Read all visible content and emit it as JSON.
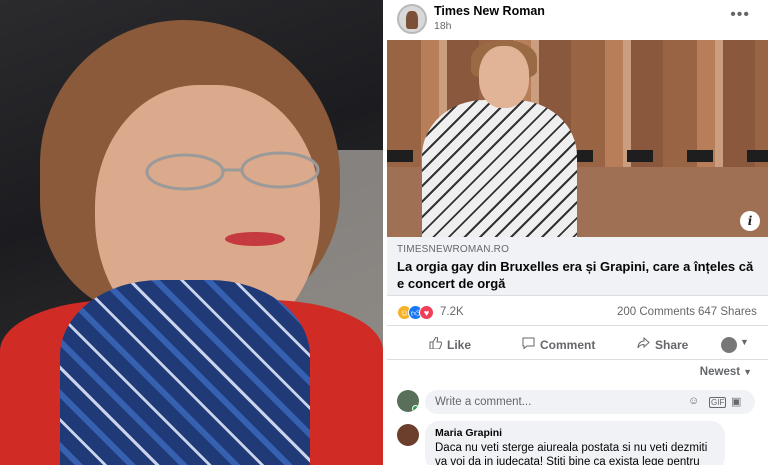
{
  "post": {
    "page_name": "Times New Roman",
    "time": "18h",
    "more_label": "•••",
    "info_label": "i",
    "link": {
      "domain": "TIMESNEWROMAN.RO",
      "title": "La orgia gay din Bruxelles era și Grapini, care a înțeles că e concert de orgă"
    },
    "stats": {
      "reactions_count": "7.2K",
      "comments": "200 Comments",
      "shares": "647 Shares"
    },
    "actions": {
      "like": "Like",
      "comment": "Comment",
      "share": "Share"
    },
    "sort_label": "Newest",
    "comment_input_placeholder": "Write a comment...",
    "top_comment": {
      "author": "Maria Grapini",
      "text": "Daca nu veti sterge aiureala postata si nu veti dezmiti va voi da in judecata! Stiti bine ca exista lege pentru stiri"
    }
  },
  "icons": {
    "reaction_haha": "haha-reaction-icon",
    "reaction_like": "like-reaction-icon",
    "reaction_love": "love-reaction-icon",
    "like": "thumbs-up-icon",
    "comment": "speech-bubble-icon",
    "share": "share-arrow-icon",
    "emoji": "emoji-icon",
    "gif": "gif-icon",
    "sticker": "sticker-icon"
  },
  "colors": {
    "facebook_blue": "#1877f2",
    "love_red": "#f33e58",
    "haha_yellow": "#f7b125",
    "secondary_text": "#65676b"
  }
}
